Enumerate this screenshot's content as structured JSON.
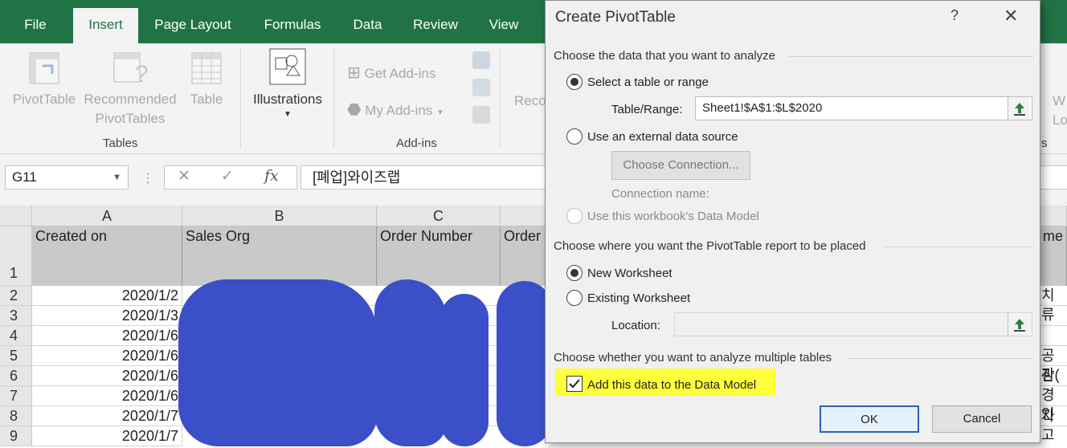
{
  "ribbon_tabs": [
    "File",
    "Insert",
    "Page Layout",
    "Formulas",
    "Data",
    "Review",
    "View"
  ],
  "ribbon": {
    "pivot_table": "PivotTable",
    "recommended_pivot_line1": "Recommended",
    "recommended_pivot_line2": "PivotTables",
    "table": "Table",
    "tables_group": "Tables",
    "illustrations": "Illustrations",
    "get_addins": "Get Add-ins",
    "my_addins": "My Add-ins",
    "addins_group": "Add-ins",
    "reco_partial": "Reco",
    "w_partial": "W",
    "lo_partial": "Lo",
    "s_partial": "s"
  },
  "formula_bar": {
    "name_box": "G11",
    "fx": "fx",
    "content": "[폐업]와이즈랩"
  },
  "grid": {
    "columns": [
      "A",
      "B",
      "C"
    ],
    "headers": [
      "Created on",
      "Sales Org",
      "Order Number",
      "Order",
      "me"
    ],
    "row_numbers": [
      "1",
      "2",
      "3",
      "4",
      "5",
      "6",
      "7",
      "8",
      "9"
    ],
    "dates": [
      "2020/1/2",
      "2020/1/3",
      "2020/1/6",
      "2020/1/6",
      "2020/1/6",
      "2020/1/6",
      "2020/1/7",
      "2020/1/7"
    ],
    "right_fragments": [
      "치 류",
      "",
      "",
      "공장(",
      "관경인",
      "",
      "자고",
      ""
    ]
  },
  "dialog": {
    "title": "Create PivotTable",
    "help": "?",
    "close": "✕",
    "section1": "Choose the data that you want to analyze",
    "opt_select_range": "Select a table or range",
    "table_range_label": "Table/Range:",
    "table_range_value": "Sheet1!$A$1:$L$2020",
    "opt_external": "Use an external data source",
    "choose_connection": "Choose Connection...",
    "connection_name": "Connection name:",
    "opt_data_model": "Use this workbook's Data Model",
    "section2": "Choose where you want the PivotTable report to be placed",
    "opt_new_ws": "New Worksheet",
    "opt_existing_ws": "Existing Worksheet",
    "location_label": "Location:",
    "location_value": "",
    "section3": "Choose whether you want to analyze multiple tables",
    "add_to_model": "Add this data to the Data Model",
    "ok": "OK",
    "cancel": "Cancel",
    "selected_option": "Select a table or range",
    "selected_placement": "New Worksheet",
    "add_to_model_checked": true
  },
  "colors": {
    "excel_green": "#217346",
    "highlight": "#ffff3c",
    "scribble": "#3a4fc8"
  }
}
